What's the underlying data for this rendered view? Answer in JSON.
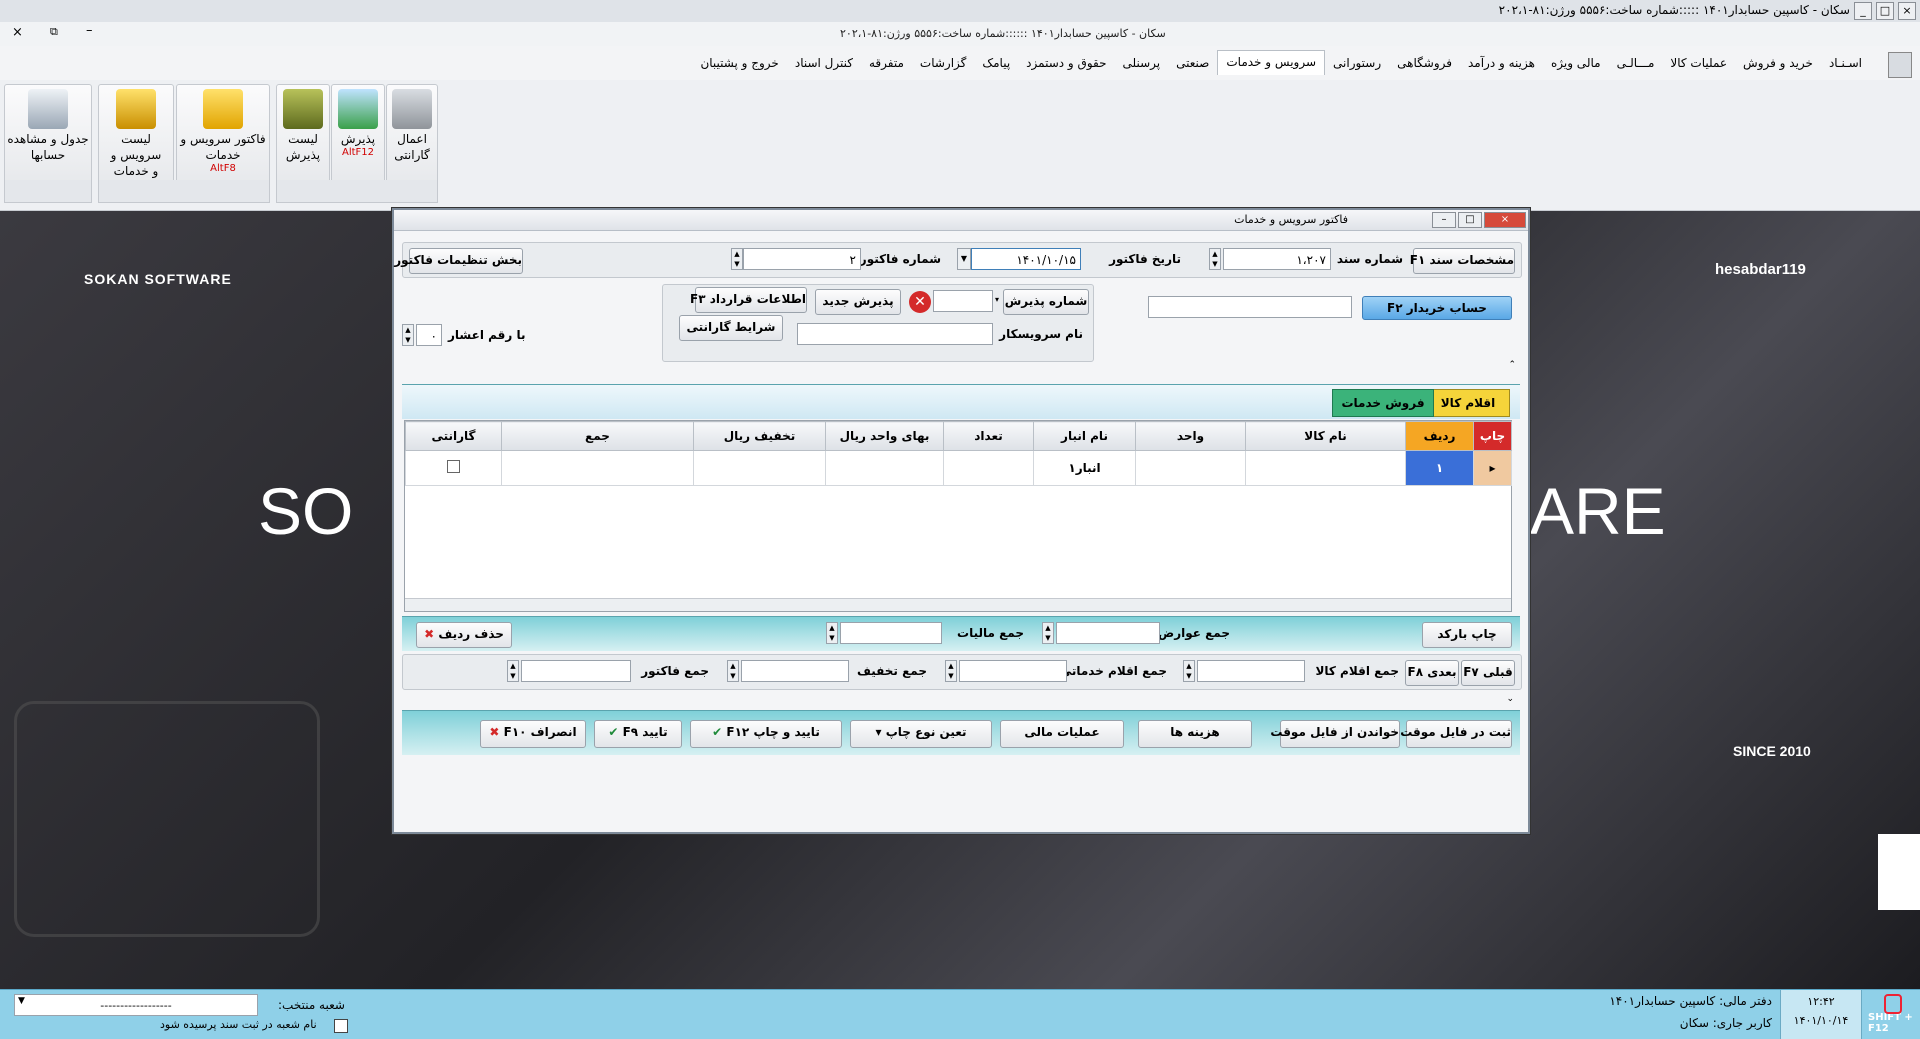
{
  "window": {
    "title": "سکان - کاسپین حسابدار۱۴۰۱ :::::شماره ساخت:۵۵۵۶ ورژن:۸۱-۲۰۲،۱",
    "subtitle": "سکان - کاسپین حسابدار۱۴۰۱ ::::::شماره ساخت:۵۵۵۶ ورژن:۸۱-۲۰۲،۱"
  },
  "menu": [
    "اسـنـاد",
    "خرید و فروش",
    "عملیات کالا",
    "مـــالـی",
    "مالی ویژه",
    "هزینه و درآمد",
    "فروشگاهی",
    "رستورانی",
    "سرویس و خدمات",
    "صنعتی",
    "پرسنلی",
    "حقوق و دستمزد",
    "پیامک",
    "گزارشات",
    "متفرقه",
    "کنترل اسناد",
    "خروج و پشتیبان"
  ],
  "ribbon": {
    "b1": {
      "l1": "اعمال",
      "l2": "گارانتی"
    },
    "b2": {
      "l1": "پذیرش",
      "hk": "AltF12"
    },
    "b3": {
      "l1": "لیست",
      "l2": "پذیرش"
    },
    "b4": {
      "l1": "فاکتور سرویس و",
      "l2": "خدمات",
      "hk": "AltF8"
    },
    "b5": {
      "l1": "لیست سرویس و",
      "l2": "و خدمات"
    },
    "b6": {
      "l1": "جدول و مشاهده",
      "l2": "حسابها"
    }
  },
  "background": {
    "brand": "SOKAN SOFTWARE",
    "user": "hesabdar119",
    "big_left": "SO",
    "big_right": "ARE",
    "since": "SINCE 2010"
  },
  "dialog": {
    "title": "فاکتور سرویس و خدمات",
    "doc_spec_btn": "مشخصات سند F۱",
    "doc_no_label": "شماره سند",
    "doc_no": "۱،۲۰۷",
    "inv_date_label": "تاریخ فاکتور",
    "inv_date": "۱۴۰۱/۱۰/۱۵",
    "inv_no_label": "شماره فاکتور",
    "inv_no": "۲",
    "settings_btn": "بخش تنظیمات فاکتور",
    "buyer_btn": "حساب خریدار F۲",
    "reception_no_btn": "شماره پذیرش",
    "new_reception_btn": "پذیرش جدید",
    "contract_btn": "اطلاعات قرارداد F۳",
    "warranty_terms_btn": "شرایط گارانتی",
    "service_person_label": "نام سرویسکار",
    "decimal_label": "با رقم اعشار",
    "decimal_value": "۰",
    "tab_goods": "اقلام کالا",
    "tab_services": "فروش خدمات",
    "columns": [
      "چاپ",
      "ردیف",
      "نام کالا",
      "واحد",
      "نام انبار",
      "تعداد",
      "بهای واحد ریال",
      "تخفیف ریال",
      "جمع",
      "گارانتی"
    ],
    "row": {
      "index": "۱",
      "warehouse": "انبار۱"
    },
    "barcode_btn": "چاپ بارکد",
    "delete_row_btn": "حذف ردیف",
    "sum_tolls_label": "جمع عوارض",
    "sum_tax_label": "جمع مالیات",
    "prev_btn": "قبلی F۷",
    "next_btn": "بعدی F۸",
    "sum_goods_label": "جمع اقلام کالا",
    "sum_services_label": "جمع اقلام خدماتی",
    "sum_discount_label": "جمع تخفیف",
    "sum_invoice_label": "جمع فاکتور",
    "save_temp_btn": "ثبت در فایل موقت",
    "read_temp_btn": "خواندن از فایل موقت",
    "costs_btn": "هزینه ها",
    "financial_btn": "عملیات مالی",
    "print_type_btn": "تعین نوع چاپ",
    "confirm_print_btn": "تایید و چاپ F۱۲",
    "confirm_btn": "تایید F۹",
    "cancel_btn": "انصراف F۱۰"
  },
  "status": {
    "branch_label": "شعبه منتخب:",
    "branch_value": "------------------",
    "branch_ask": "نام شعبه در ثبت سند پرسیده شود",
    "fiscal": "دفتر مالی: کاسپین حسابدار۱۴۰۱",
    "user": "کاربر جاری: سکان",
    "time": "۱۲:۴۲",
    "date": "۱۴۰۱/۱۰/۱۴",
    "shift": "SHIFT + F12"
  },
  "colors": {
    "accent": "#5aa8e6",
    "teal": "#7fd0d8",
    "statusbar": "#8fd0e8",
    "row_index": "#3a6fd8",
    "tab_goods": "#f5d43a",
    "tab_services": "#3bb37a"
  }
}
